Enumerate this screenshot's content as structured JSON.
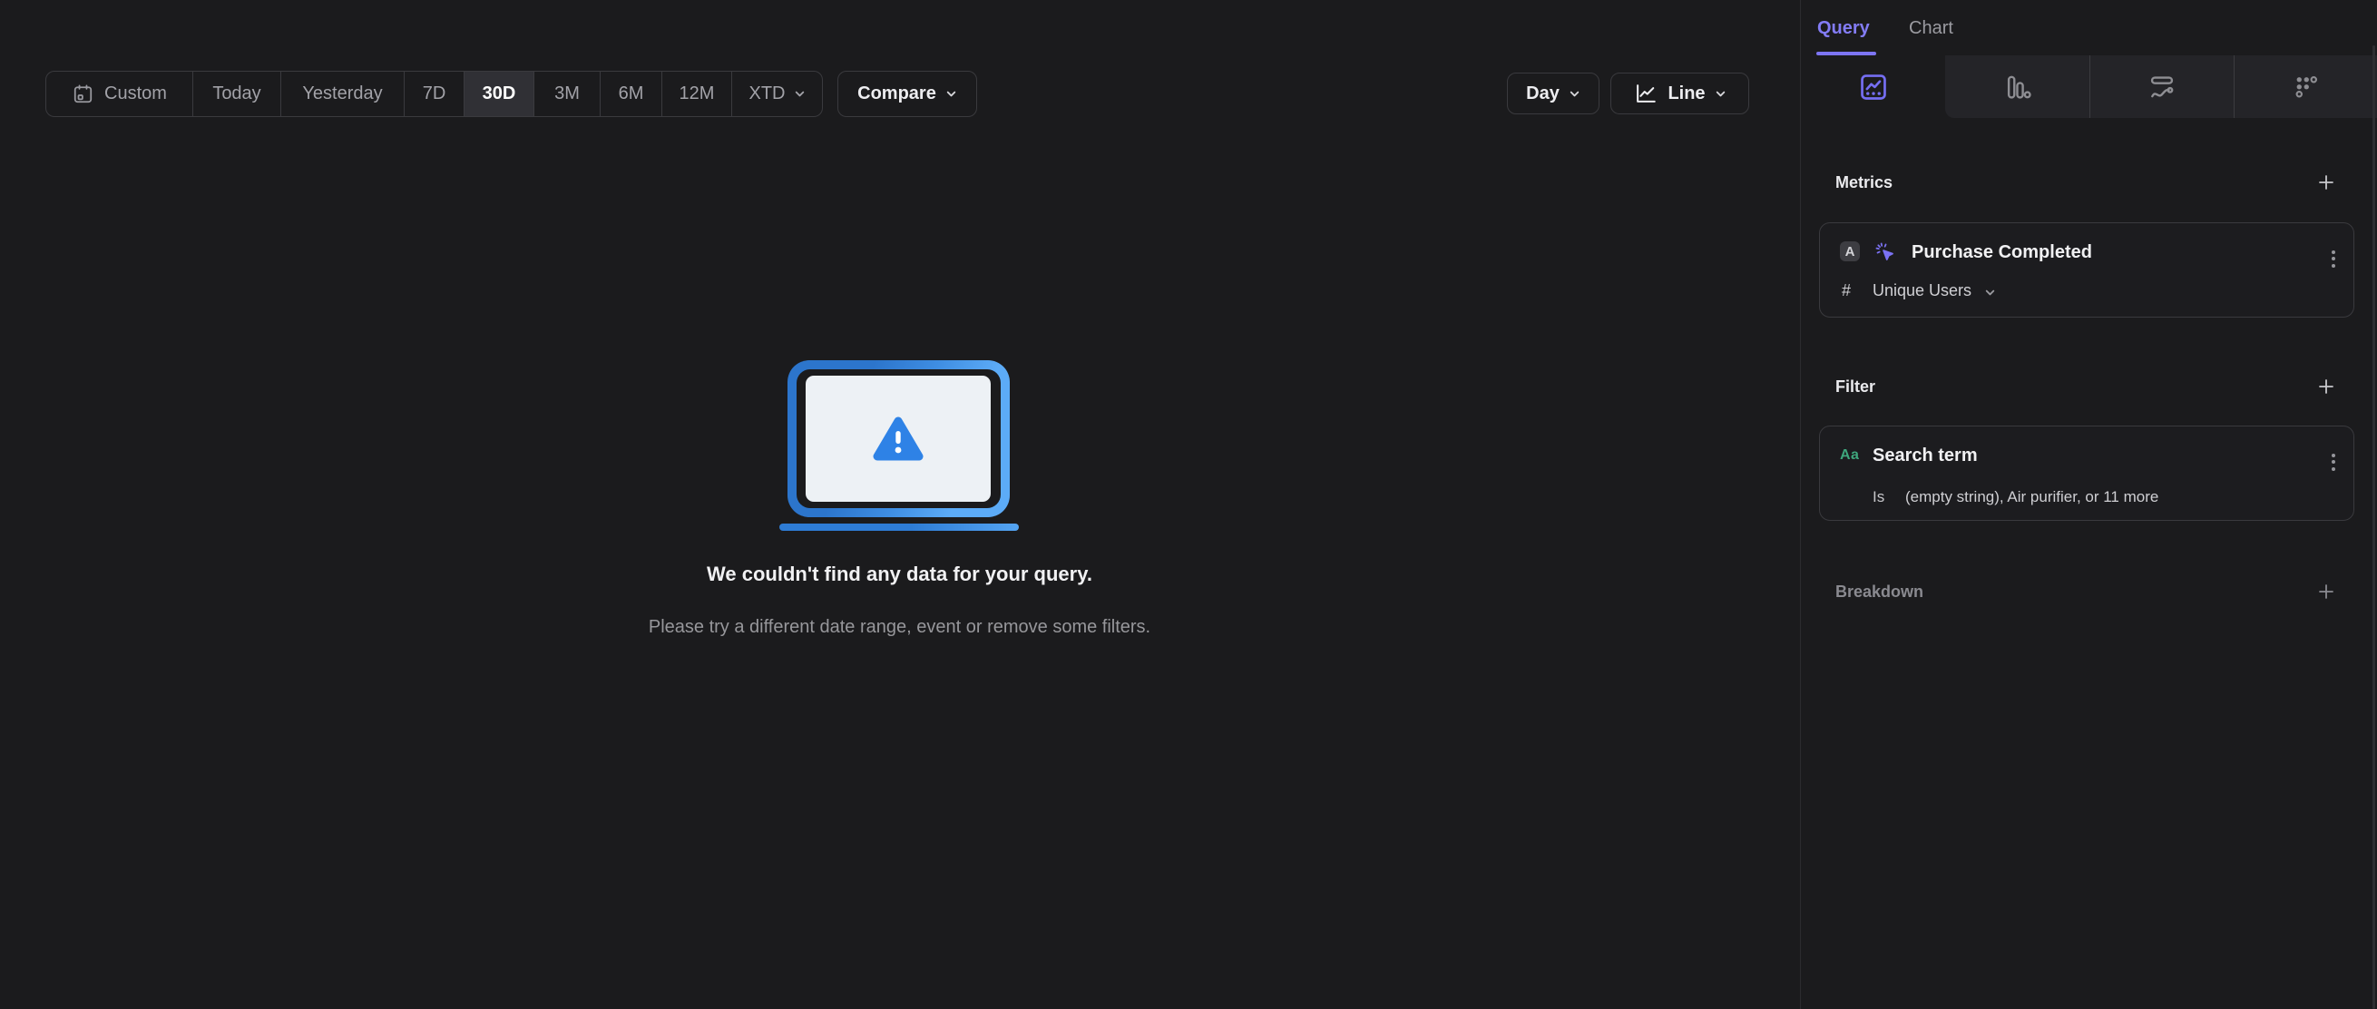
{
  "toolbar": {
    "date_ranges": [
      {
        "label": "Custom"
      },
      {
        "label": "Today"
      },
      {
        "label": "Yesterday"
      },
      {
        "label": "7D"
      },
      {
        "label": "30D"
      },
      {
        "label": "3M"
      },
      {
        "label": "6M"
      },
      {
        "label": "12M"
      },
      {
        "label": "XTD"
      }
    ],
    "selected_range": "30D",
    "compare_label": "Compare",
    "granularity_label": "Day",
    "chart_type_label": "Line"
  },
  "empty_state": {
    "title": "We couldn't find any data for your query.",
    "subtitle": "Please try a different date range, event or remove some filters."
  },
  "sidebar": {
    "tabs": [
      {
        "label": "Query"
      },
      {
        "label": "Chart"
      }
    ],
    "active_tab": "Query",
    "report_type_tabs": [
      "insights",
      "funnels",
      "flows",
      "retention"
    ],
    "active_report_type": "insights",
    "metrics": {
      "heading": "Metrics",
      "items": [
        {
          "letter": "A",
          "event_name": "Purchase Completed",
          "aggregation_symbol": "#",
          "aggregation": "Unique Users"
        }
      ]
    },
    "filter": {
      "heading": "Filter",
      "items": [
        {
          "type_label": "Aa",
          "property": "Search term",
          "operator": "Is",
          "value": "(empty string), Air purifier, or 11 more"
        }
      ]
    },
    "breakdown": {
      "heading": "Breakdown"
    }
  },
  "colors": {
    "accent_purple": "#7d75f4",
    "accent_green": "#3ea67c",
    "accent_blue": "#2e82e6",
    "background": "#1b1b1d"
  }
}
